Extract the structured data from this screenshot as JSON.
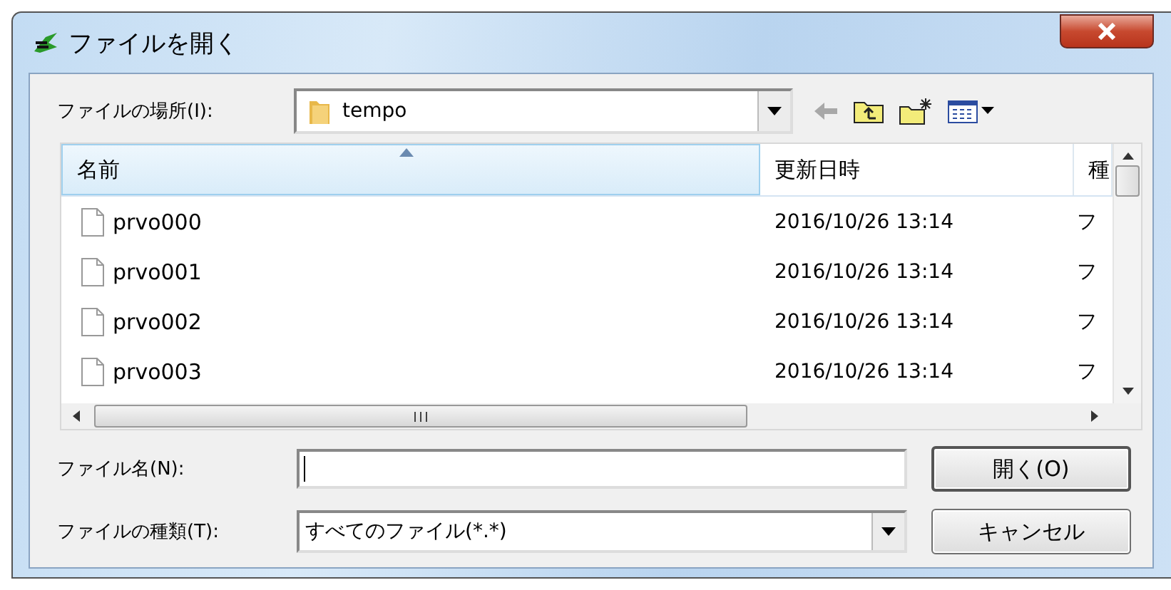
{
  "window": {
    "title": "ファイルを開く"
  },
  "location": {
    "label": "ファイルの場所(I):",
    "value": "tempo"
  },
  "file_list": {
    "columns": [
      {
        "label": "名前",
        "sorted": true
      },
      {
        "label": "更新日時",
        "sorted": false
      },
      {
        "label": "種",
        "sorted": false
      }
    ],
    "rows": [
      {
        "name": "prvo000",
        "modified": "2016/10/26 13:14",
        "column_3": "フ"
      },
      {
        "name": "prvo001",
        "modified": "2016/10/26 13:14",
        "column_3": "フ"
      },
      {
        "name": "prvo002",
        "modified": "2016/10/26 13:14",
        "column_3": "フ"
      },
      {
        "name": "prvo003",
        "modified": "2016/10/26 13:14",
        "column_3": "フ"
      }
    ]
  },
  "file_name": {
    "label": "ファイル名(N):"
  },
  "file_type": {
    "label": "ファイルの種類(T):",
    "value": "すべてのファイル(*.*)"
  },
  "buttons": [
    "開く(O)",
    "キャンセル"
  ]
}
